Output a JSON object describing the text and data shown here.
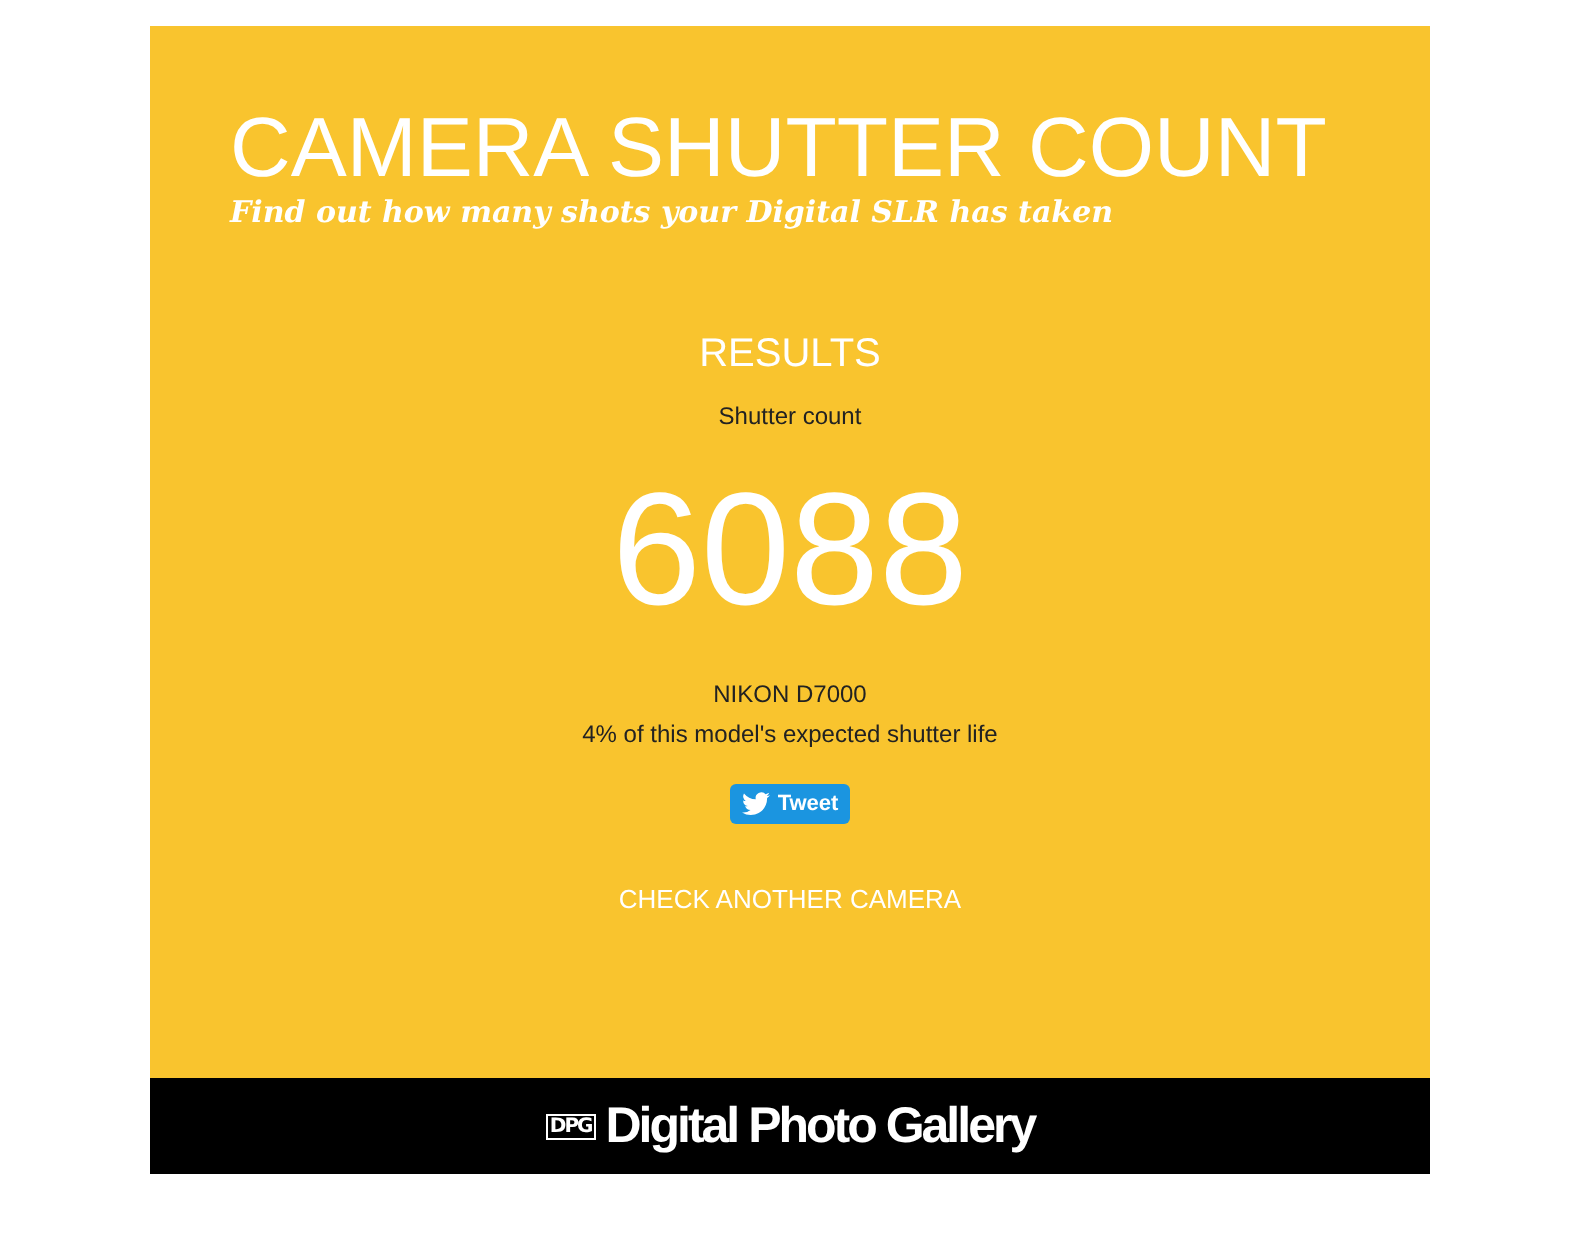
{
  "header": {
    "title": "CAMERA SHUTTER COUNT",
    "subtitle": "Find out how many shots your Digital SLR has taken"
  },
  "results": {
    "heading": "RESULTS",
    "count_label": "Shutter count",
    "count": "6088",
    "model": "NIKON D7000",
    "life_note": "4% of this model's expected shutter life",
    "tweet_button": "Tweet",
    "check_link": "CHECK ANOTHER CAMERA"
  },
  "footer": {
    "logo_mark": "DPG",
    "logo_text": "Digital Photo Gallery"
  }
}
